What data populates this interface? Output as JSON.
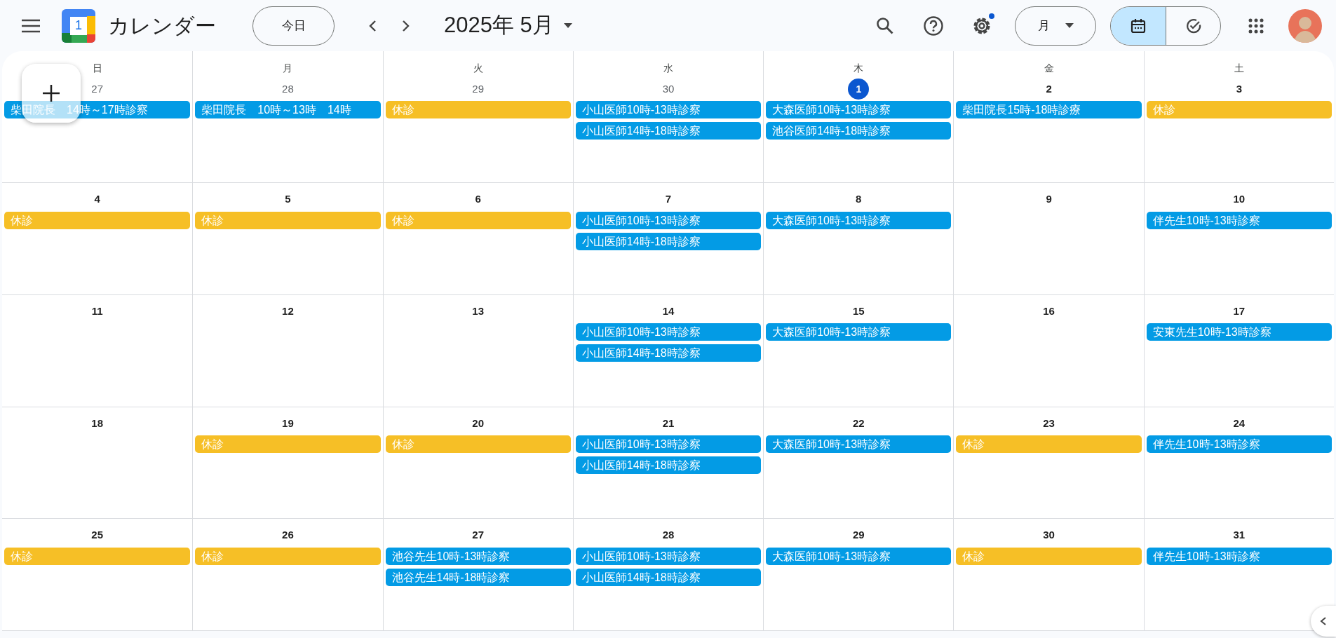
{
  "header": {
    "logo_text": "1",
    "app_name": "カレンダー",
    "today_button": "今日",
    "period": "2025年 5月",
    "view_button": "月",
    "settings_badge": true,
    "view_toggle": [
      {
        "kind": "calendar",
        "selected": true
      },
      {
        "kind": "tasks",
        "selected": false
      }
    ]
  },
  "weekdays": [
    "日",
    "月",
    "火",
    "水",
    "木",
    "金",
    "土"
  ],
  "weeks": [
    {
      "days": [
        {
          "label": "27",
          "in_month": false,
          "today": false,
          "events": [
            {
              "title": "柴田院長　14時～17時診察",
              "color": "#039be5"
            }
          ]
        },
        {
          "label": "28",
          "in_month": false,
          "today": false,
          "events": [
            {
              "title": "柴田院長　10時～13時　14時",
              "color": "#039be5"
            }
          ]
        },
        {
          "label": "29",
          "in_month": false,
          "today": false,
          "events": [
            {
              "title": "休診",
              "color": "#f6bf26"
            }
          ]
        },
        {
          "label": "30",
          "in_month": false,
          "today": false,
          "events": [
            {
              "title": "小山医師10時-13時診察",
              "color": "#039be5"
            },
            {
              "title": "小山医師14時-18時診察",
              "color": "#039be5"
            }
          ]
        },
        {
          "label": "1",
          "in_month": true,
          "today": true,
          "events": [
            {
              "title": "大森医師10時-13時診察",
              "color": "#039be5"
            },
            {
              "title": "池谷医師14時-18時診察",
              "color": "#039be5"
            }
          ]
        },
        {
          "label": "2",
          "in_month": true,
          "today": false,
          "events": [
            {
              "title": "柴田院長15時-18時診療",
              "color": "#039be5"
            }
          ]
        },
        {
          "label": "3",
          "in_month": true,
          "today": false,
          "events": [
            {
              "title": "休診",
              "color": "#f6bf26"
            }
          ]
        }
      ]
    },
    {
      "days": [
        {
          "label": "4",
          "in_month": true,
          "today": false,
          "events": [
            {
              "title": "休診",
              "color": "#f6bf26"
            }
          ]
        },
        {
          "label": "5",
          "in_month": true,
          "today": false,
          "events": [
            {
              "title": "休診",
              "color": "#f6bf26"
            }
          ]
        },
        {
          "label": "6",
          "in_month": true,
          "today": false,
          "events": [
            {
              "title": "休診",
              "color": "#f6bf26"
            }
          ]
        },
        {
          "label": "7",
          "in_month": true,
          "today": false,
          "events": [
            {
              "title": "小山医師10時-13時診察",
              "color": "#039be5"
            },
            {
              "title": "小山医師14時-18時診察",
              "color": "#039be5"
            }
          ]
        },
        {
          "label": "8",
          "in_month": true,
          "today": false,
          "events": [
            {
              "title": "大森医師10時-13時診察",
              "color": "#039be5"
            }
          ]
        },
        {
          "label": "9",
          "in_month": true,
          "today": false
        },
        {
          "label": "10",
          "in_month": true,
          "today": false,
          "events": [
            {
              "title": "伴先生10時-13時診察",
              "color": "#039be5"
            }
          ]
        }
      ]
    },
    {
      "days": [
        {
          "label": "11",
          "in_month": true,
          "today": false
        },
        {
          "label": "12",
          "in_month": true,
          "today": false
        },
        {
          "label": "13",
          "in_month": true,
          "today": false
        },
        {
          "label": "14",
          "in_month": true,
          "today": false,
          "events": [
            {
              "title": "小山医師10時-13時診察",
              "color": "#039be5"
            },
            {
              "title": "小山医師14時-18時診察",
              "color": "#039be5"
            }
          ]
        },
        {
          "label": "15",
          "in_month": true,
          "today": false,
          "events": [
            {
              "title": "大森医師10時-13時診察",
              "color": "#039be5"
            }
          ]
        },
        {
          "label": "16",
          "in_month": true,
          "today": false
        },
        {
          "label": "17",
          "in_month": true,
          "today": false,
          "events": [
            {
              "title": "安東先生10時-13時診察",
              "color": "#039be5"
            }
          ]
        }
      ]
    },
    {
      "days": [
        {
          "label": "18",
          "in_month": true,
          "today": false
        },
        {
          "label": "19",
          "in_month": true,
          "today": false,
          "events": [
            {
              "title": "休診",
              "color": "#f6bf26"
            }
          ]
        },
        {
          "label": "20",
          "in_month": true,
          "today": false,
          "events": [
            {
              "title": "休診",
              "color": "#f6bf26"
            }
          ]
        },
        {
          "label": "21",
          "in_month": true,
          "today": false,
          "events": [
            {
              "title": "小山医師10時-13時診察",
              "color": "#039be5"
            },
            {
              "title": "小山医師14時-18時診察",
              "color": "#039be5"
            }
          ]
        },
        {
          "label": "22",
          "in_month": true,
          "today": false,
          "events": [
            {
              "title": "大森医師10時-13時診察",
              "color": "#039be5"
            }
          ]
        },
        {
          "label": "23",
          "in_month": true,
          "today": false,
          "events": [
            {
              "title": "休診",
              "color": "#f6bf26"
            }
          ]
        },
        {
          "label": "24",
          "in_month": true,
          "today": false,
          "events": [
            {
              "title": "伴先生10時-13時診察",
              "color": "#039be5"
            }
          ]
        }
      ]
    },
    {
      "days": [
        {
          "label": "25",
          "in_month": true,
          "today": false,
          "events": [
            {
              "title": "休診",
              "color": "#f6bf26"
            }
          ]
        },
        {
          "label": "26",
          "in_month": true,
          "today": false,
          "events": [
            {
              "title": "休診",
              "color": "#f6bf26"
            }
          ]
        },
        {
          "label": "27",
          "in_month": true,
          "today": false,
          "events": [
            {
              "title": "池谷先生10時-13時診察",
              "color": "#039be5"
            },
            {
              "title": "池谷先生14時-18時診察",
              "color": "#039be5"
            }
          ]
        },
        {
          "label": "28",
          "in_month": true,
          "today": false,
          "events": [
            {
              "title": "小山医師10時-13時診察",
              "color": "#039be5"
            },
            {
              "title": "小山医師14時-18時診察",
              "color": "#039be5"
            }
          ]
        },
        {
          "label": "29",
          "in_month": true,
          "today": false,
          "events": [
            {
              "title": "大森医師10時-13時診察",
              "color": "#039be5"
            }
          ]
        },
        {
          "label": "30",
          "in_month": true,
          "today": false,
          "events": [
            {
              "title": "休診",
              "color": "#f6bf26"
            }
          ]
        },
        {
          "label": "31",
          "in_month": true,
          "today": false,
          "events": [
            {
              "title": "伴先生10時-13時診察",
              "color": "#039be5"
            }
          ]
        }
      ]
    }
  ]
}
